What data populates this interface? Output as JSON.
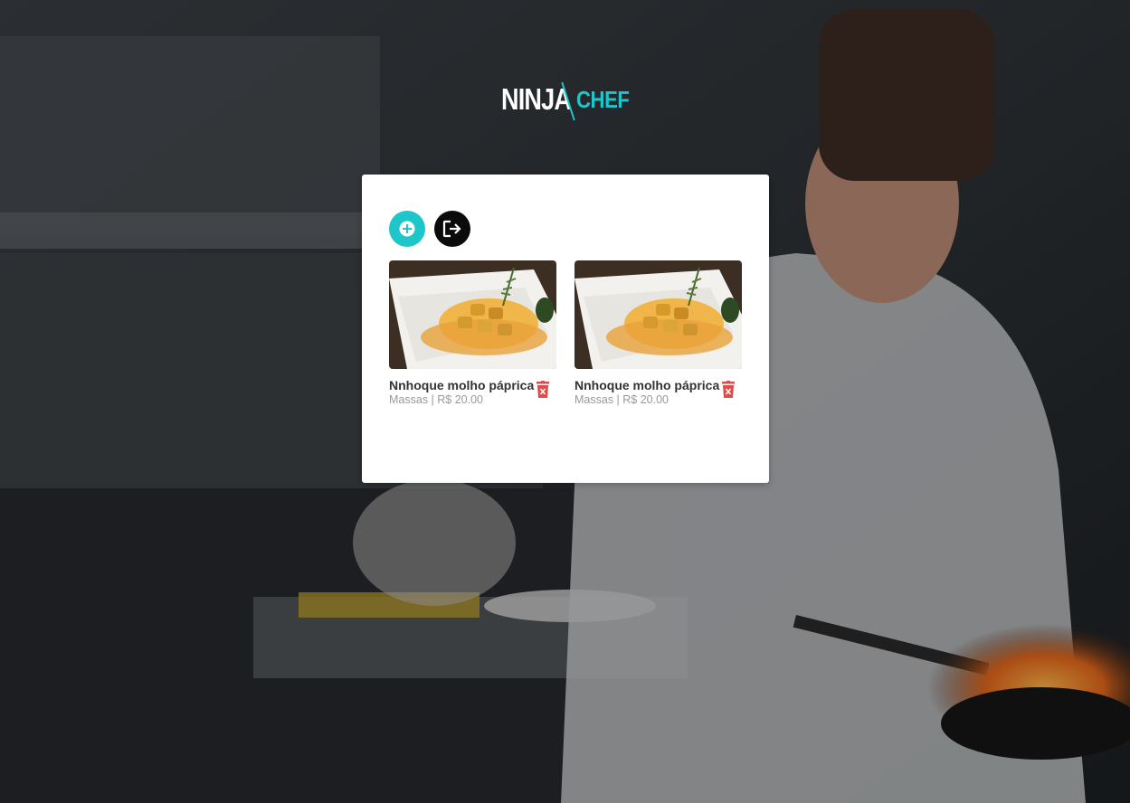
{
  "brand": {
    "part1": "NINJA",
    "part2": "CHEF",
    "accent_color": "#1ec6c9"
  },
  "toolbar": {
    "add_icon": "plus-circle-icon",
    "logout_icon": "sign-out-icon"
  },
  "items": [
    {
      "name": "Nnhoque molho páprica",
      "category": "Massas",
      "separator": " | ",
      "price": "R$ 20.00",
      "delete_icon": "trash-icon"
    },
    {
      "name": "Nnhoque molho páprica",
      "category": "Massas",
      "separator": " | ",
      "price": "R$ 20.00",
      "delete_icon": "trash-icon"
    }
  ],
  "colors": {
    "delete": "#e04b4b",
    "logout_bg": "#0b0b0b"
  }
}
